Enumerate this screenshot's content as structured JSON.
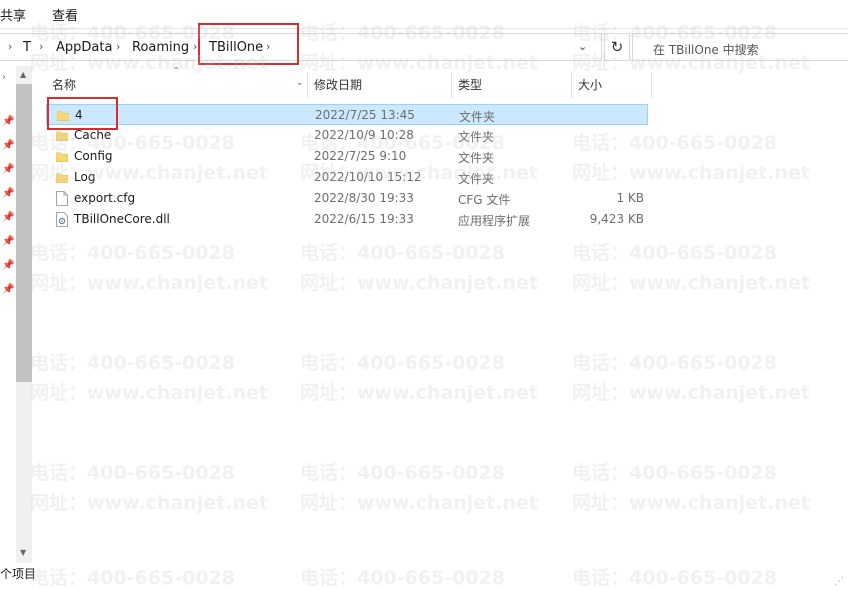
{
  "ribbon": {
    "tabs": [
      "共享",
      "查看"
    ]
  },
  "address": {
    "crumbs": [
      "T",
      "AppData",
      "Roaming",
      "TBillOne"
    ],
    "separator": "›",
    "dropdown": "⌄",
    "refresh": "↻"
  },
  "search": {
    "placeholder": "在 TBillOne 中搜索"
  },
  "columns": {
    "name": "名称",
    "date": "修改日期",
    "type": "类型",
    "size": "大小"
  },
  "files": [
    {
      "name": "4",
      "date": "2022/7/25 13:45",
      "type": "文件夹",
      "size": "",
      "icon": "folder-icon",
      "selected": true
    },
    {
      "name": "Cache",
      "date": "2022/10/9 10:28",
      "type": "文件夹",
      "size": "",
      "icon": "folder-icon",
      "selected": false
    },
    {
      "name": "Config",
      "date": "2022/7/25 9:10",
      "type": "文件夹",
      "size": "",
      "icon": "folder-icon",
      "selected": false
    },
    {
      "name": "Log",
      "date": "2022/10/10 15:12",
      "type": "文件夹",
      "size": "",
      "icon": "folder-icon",
      "selected": false
    },
    {
      "name": "export.cfg",
      "date": "2022/8/30 19:33",
      "type": "CFG 文件",
      "size": "1 KB",
      "icon": "file-icon",
      "selected": false
    },
    {
      "name": "TBillOneCore.dll",
      "date": "2022/6/15 19:33",
      "type": "应用程序扩展",
      "size": "9,423 KB",
      "icon": "dll-icon",
      "selected": false
    }
  ],
  "status": {
    "text": "个项目"
  },
  "watermark": {
    "phone": "电话：400-665-0028",
    "site": "网址：www.chanjet.net"
  },
  "colors": {
    "selection": "#cce8ff",
    "selection_border": "#99d1ff",
    "folder": "#f8d775",
    "highlight_box": "#d62e2e"
  }
}
